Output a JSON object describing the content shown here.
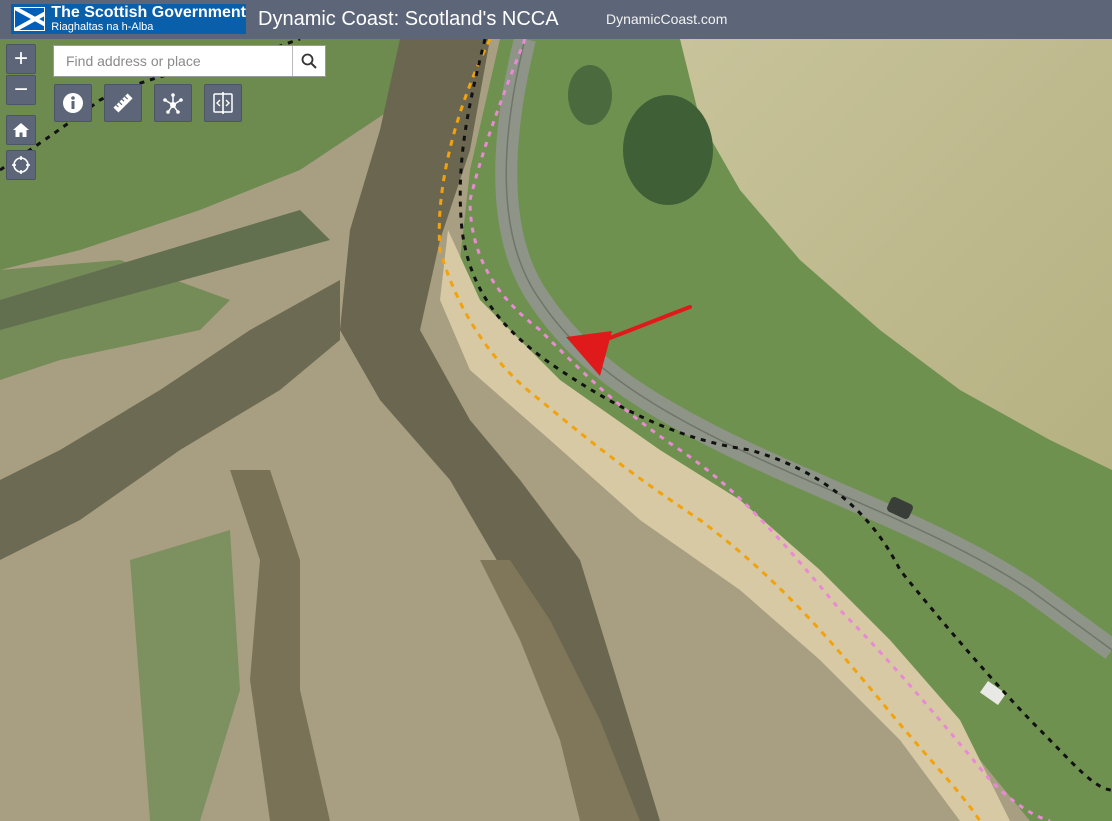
{
  "header": {
    "gov_name": "The Scottish Government",
    "gov_gaelic": "Riaghaltas na h-Alba",
    "app_title": "Dynamic Coast: Scotland's NCCA",
    "site_link": "DynamicCoast.com"
  },
  "search": {
    "placeholder": "Find address or place"
  },
  "controls": {
    "zoom_in": "+",
    "zoom_out": "−"
  },
  "icons": {
    "zoom_in": "plus-icon",
    "zoom_out": "minus-icon",
    "home": "home-icon",
    "locate": "locate-icon",
    "search": "search-icon",
    "info": "info-icon",
    "measure": "ruler-icon",
    "share": "share-icon",
    "swipe": "swipe-icon",
    "arrow": "arrow-annotation-icon"
  },
  "colors": {
    "header_bg": "#5d6678",
    "gov_blue": "#0a5fab",
    "line_black": "#111111",
    "line_orange": "#f2a20c",
    "line_pink": "#e88ad4",
    "arrow_red": "#e01a1a"
  }
}
